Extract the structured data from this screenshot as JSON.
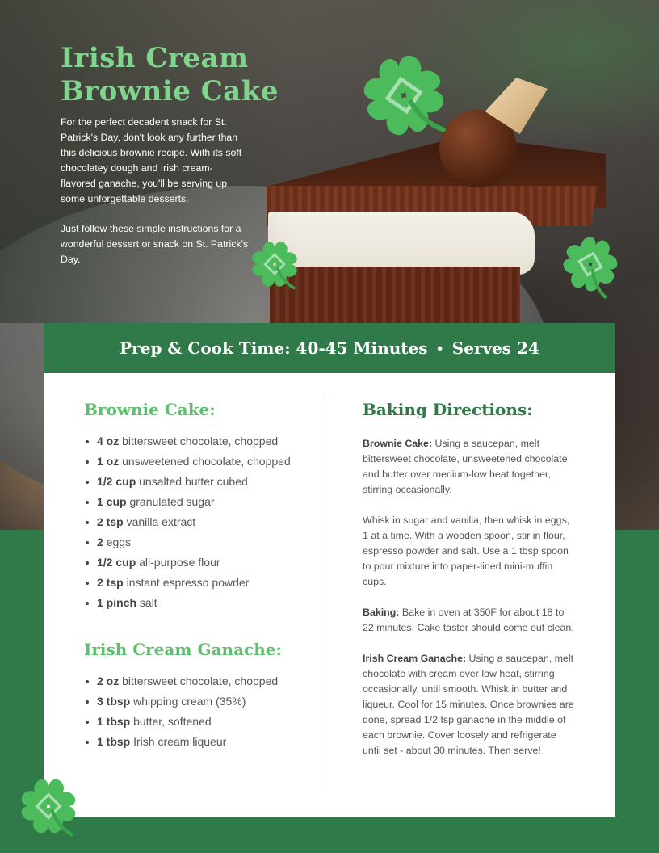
{
  "recipe": {
    "title_line1": "Irish Cream",
    "title_line2": "Brownie Cake",
    "intro_p1": "For the perfect decadent snack for St. Patrick's Day, don't look any further than this delicious brownie recipe. With its soft chocolatey dough and Irish cream-flavored ganache, you'll be serving up some unforgettable desserts.",
    "intro_p2": "Just follow these simple instructions for a wonderful dessert or snack on St. Patrick's Day."
  },
  "banner": {
    "prep": "Prep & Cook Time: 40-45 Minutes",
    "separator": "•",
    "serves": "Serves 24"
  },
  "brownie_cake": {
    "heading": "Brownie Cake:",
    "items": [
      {
        "qty": "4 oz",
        "text": " bittersweet chocolate, chopped"
      },
      {
        "qty": "1 oz",
        "text": " unsweetened chocolate, chopped"
      },
      {
        "qty": "1/2 cup",
        "text": " unsalted butter cubed"
      },
      {
        "qty": "1 cup",
        "text": " granulated sugar"
      },
      {
        "qty": "2 tsp",
        "text": " vanilla extract"
      },
      {
        "qty": "2",
        "text": " eggs"
      },
      {
        "qty": "1/2 cup",
        "text": " all-purpose flour"
      },
      {
        "qty": "2 tsp",
        "text": " instant espresso powder"
      },
      {
        "qty": "1 pinch",
        "text": " salt"
      }
    ]
  },
  "ganache": {
    "heading": "Irish Cream Ganache:",
    "items": [
      {
        "qty": "2 oz",
        "text": " bittersweet chocolate, chopped"
      },
      {
        "qty": "3 tbsp",
        "text": " whipping cream (35%)"
      },
      {
        "qty": "1 tbsp",
        "text": " butter, softened"
      },
      {
        "qty": "1 tbsp",
        "text": " Irish cream liqueur"
      }
    ]
  },
  "directions": {
    "heading": "Baking Directions:",
    "p1_label": "Brownie Cake:",
    "p1_text": " Using a saucepan, melt bittersweet chocolate, unsweetened chocolate and butter over medium-low heat together, stirring occasionally.",
    "p2_text": "Whisk in sugar and vanilla, then whisk in eggs, 1 at a time. With a wooden spoon, stir in flour, espresso powder and salt. Use a 1 tbsp spoon to pour mixture into paper-lined mini-muffin cups.",
    "p3_label": "Baking:",
    "p3_text": " Bake in oven at 350F for about 18 to 22 minutes. Cake taster should come out clean.",
    "p4_label": "Irish Cream Ganache:",
    "p4_text": " Using a saucepan, melt chocolate with cream over low heat, stirring occasionally, until smooth. Whisk in butter and liqueur. Cool for 15 minutes. Once brownies are done, spread 1/2 tsp ganache in the middle of each brownie. Cover loosely and refrigerate until set - about 30 minutes. Then serve!"
  },
  "colors": {
    "brand_green": "#2f7a48",
    "accent_green": "#5cc06c",
    "title_green": "#7fd58c",
    "text_gray": "#555555"
  },
  "icons": [
    "cake-photo",
    "clover-icon"
  ]
}
